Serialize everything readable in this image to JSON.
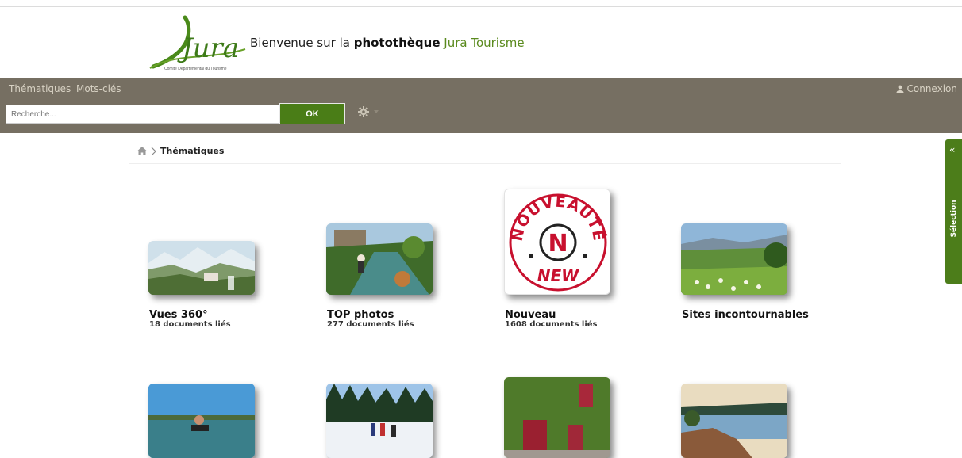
{
  "header": {
    "logo_text": "Jura",
    "logo_subtext": "Comité Départemental du Tourisme",
    "welcome_prefix": "Bienvenue sur la ",
    "welcome_bold": "photothèque",
    "welcome_brand": " Jura Tourisme"
  },
  "navbar": {
    "links": [
      "Thématiques",
      "Mots-clés"
    ],
    "connexion_label": "Connexion",
    "search_placeholder": "Recherche...",
    "ok_label": "OK"
  },
  "breadcrumb": {
    "current": "Thématiques"
  },
  "tiles": [
    {
      "title": "Vues 360°",
      "count": "18 documents liés",
      "image": "panorama-valley"
    },
    {
      "title": "TOP photos",
      "count": "277 documents liés",
      "image": "river-paddler"
    },
    {
      "title": "Nouveau",
      "count": "1608 documents liés",
      "image": "nouveaute-badge",
      "badge_top": "NOUVEAUTÉ",
      "badge_letter": "N",
      "badge_bottom": "NEW"
    },
    {
      "title": "Sites incontournables",
      "count": "",
      "image": "green-hills"
    },
    {
      "title": "",
      "count": "",
      "image": "lake-swimmer"
    },
    {
      "title": "",
      "count": "",
      "image": "ski-trail"
    },
    {
      "title": "",
      "count": "",
      "image": "ivy-house"
    },
    {
      "title": "",
      "count": "",
      "image": "lake-sunrise"
    }
  ],
  "side_panel": {
    "label": "Sélection"
  },
  "colors": {
    "navbar": "#766f62",
    "accent_green": "#4a7d17",
    "brand_green": "#5a8a1e",
    "badge_red": "#c8102e"
  }
}
